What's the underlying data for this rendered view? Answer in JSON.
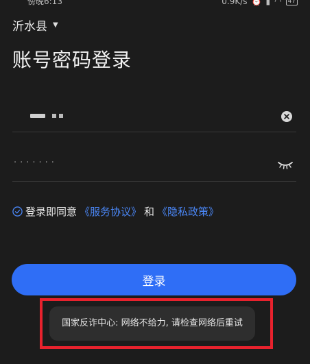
{
  "status_bar": {
    "time": "傍晚6:13",
    "network_speed": "0.9K/s",
    "battery": "47"
  },
  "header": {
    "region": "沂水县",
    "title": "账号密码登录"
  },
  "form": {
    "password_mask": "·······"
  },
  "agreement": {
    "prefix": "登录即同意",
    "service_link": "《服务协议》",
    "and": "和",
    "privacy_link": "《隐私政策》"
  },
  "login_button": "登录",
  "toast": {
    "message": "国家反诈中心: 网络不给力, 请检查网络后重试"
  },
  "colors": {
    "background": "#1c1c1c",
    "accent": "#2f6ef6",
    "link": "#4a86f5",
    "highlight": "#e8222d"
  },
  "icons": {
    "clear": "clear-icon",
    "eye_closed": "eye-closed-icon",
    "check": "check-circle-icon",
    "caret": "caret-down-icon"
  }
}
